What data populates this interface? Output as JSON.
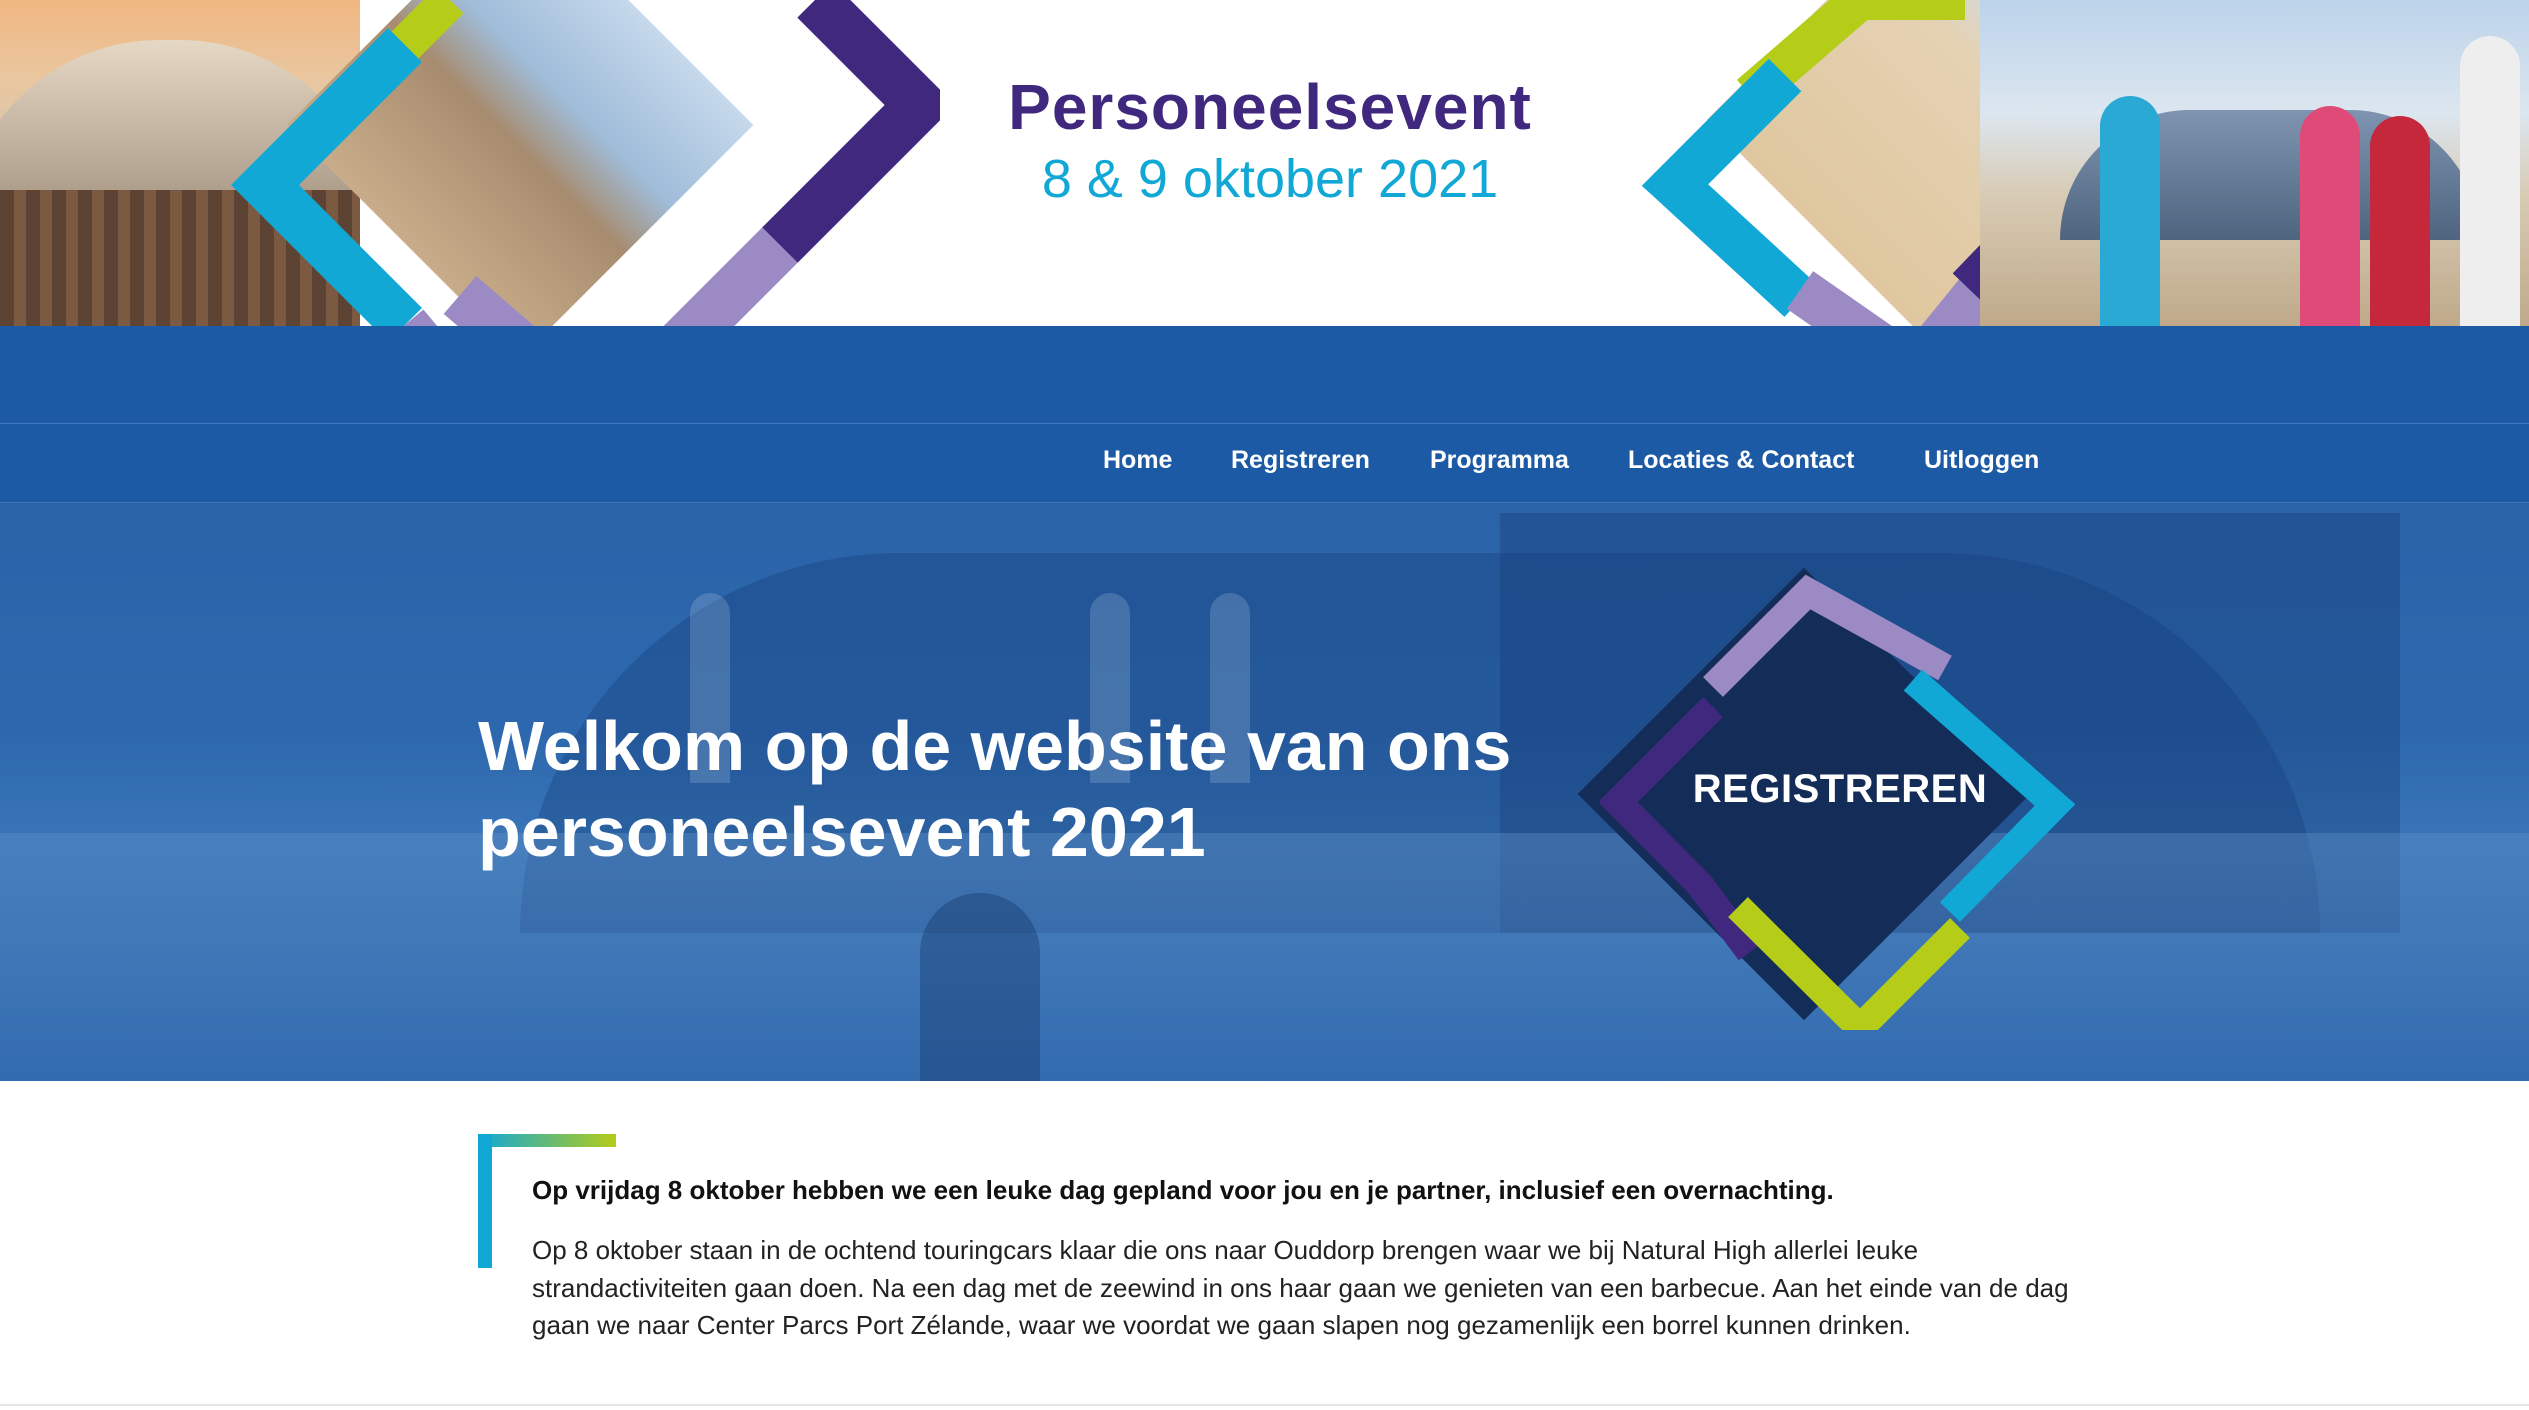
{
  "header": {
    "title": "Personeelsevent",
    "dates": "8 & 9 oktober 2021"
  },
  "nav": {
    "items": [
      {
        "label": "Home"
      },
      {
        "label": "Registreren"
      },
      {
        "label": "Programma"
      },
      {
        "label": "Locaties & Contact"
      },
      {
        "label": "Uitloggen"
      }
    ]
  },
  "hero": {
    "heading": "Welkom op de website van ons personeelsevent 2021",
    "cta_label": "REGISTREREN"
  },
  "content": {
    "intro_bold": "Op vrijdag 8 oktober hebben we een leuke dag gepland voor jou en je partner, inclusief een overnachting.",
    "intro_text": "Op 8 oktober staan in de ochtend touringcars klaar die ons naar Ouddorp brengen waar we bij Natural High allerlei leuke strandactiviteiten gaan doen. Na een dag met de zeewind in ons haar gaan we genieten van een barbecue. Aan het einde van de dag gaan we naar Center Parcs Port Zélande, waar we voordat we gaan slapen nog gezamenlijk een borrel kunnen drinken."
  },
  "colors": {
    "purple": "#40287f",
    "cyan": "#12a8d6",
    "lilac": "#9b8ac4",
    "lime": "#b5cc18",
    "nav_blue": "#1d5aa5"
  }
}
